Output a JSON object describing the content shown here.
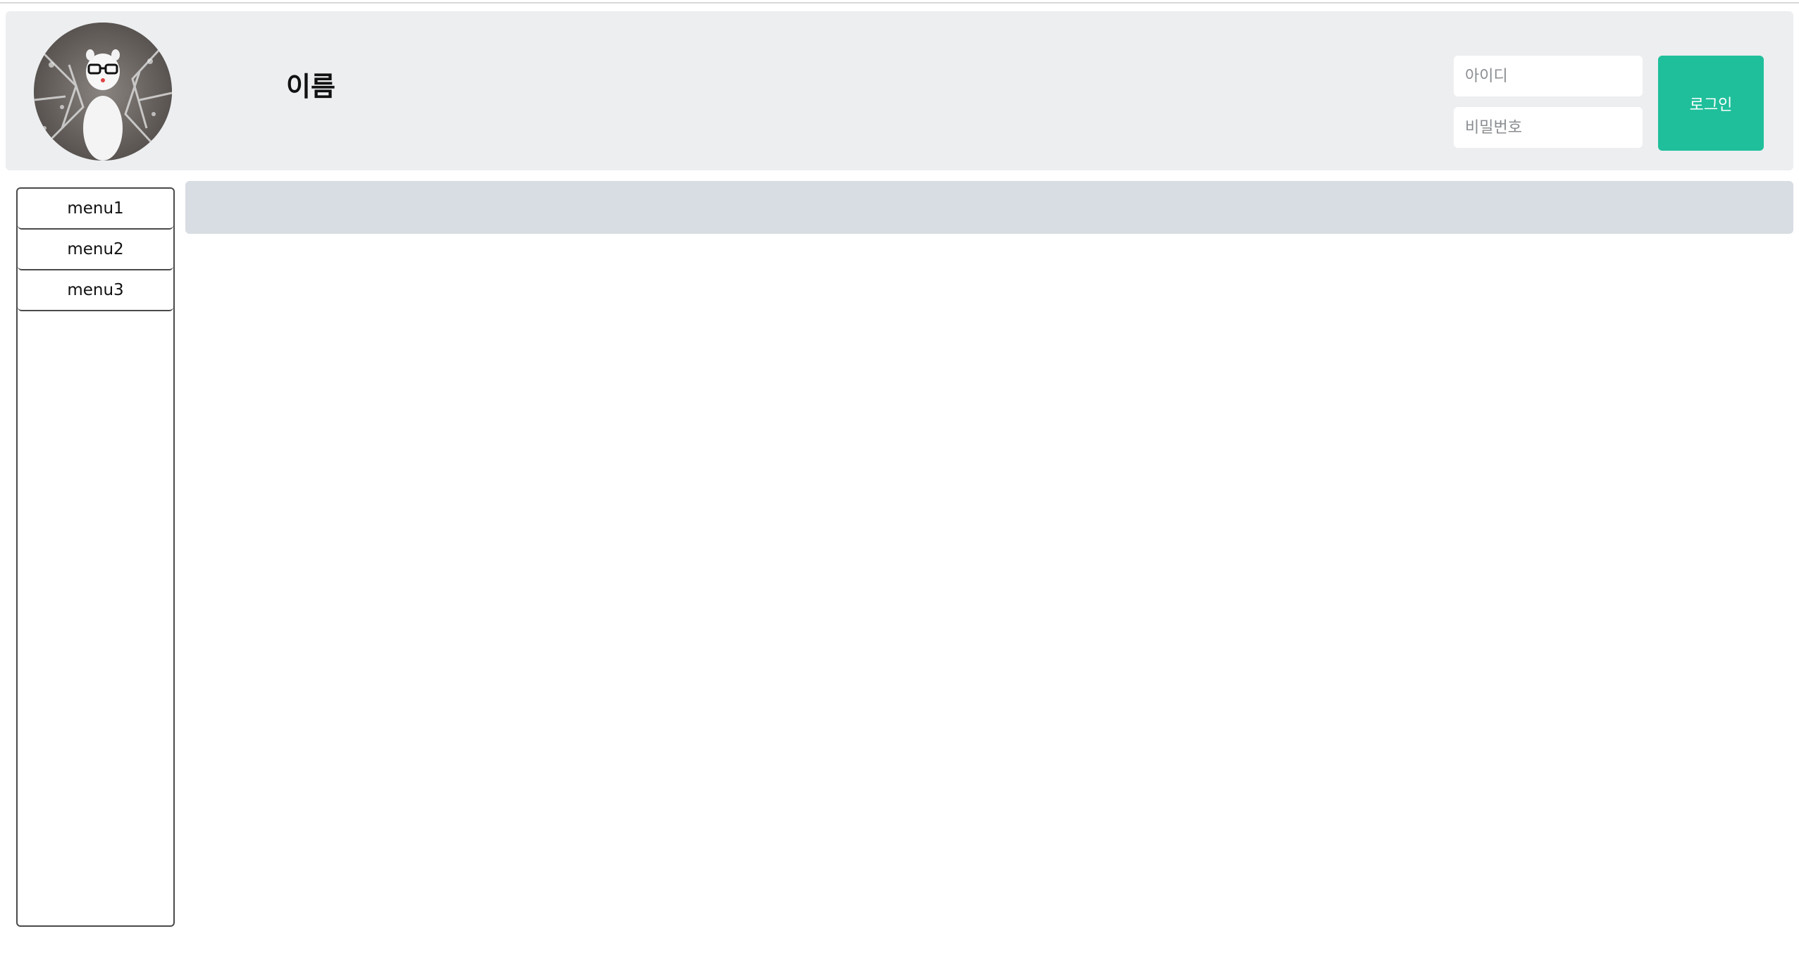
{
  "header": {
    "title": "이름",
    "avatar_alt": "avatar-photo"
  },
  "login": {
    "id_placeholder": "아이디",
    "password_placeholder": "비밀번호",
    "button_label": "로그인"
  },
  "sidebar": {
    "items": [
      {
        "label": "menu1"
      },
      {
        "label": "menu2"
      },
      {
        "label": "menu3"
      }
    ]
  },
  "colors": {
    "header_bg": "#eceef0",
    "accent": "#1fbf9b",
    "content_bar_bg": "#d8dce3"
  }
}
